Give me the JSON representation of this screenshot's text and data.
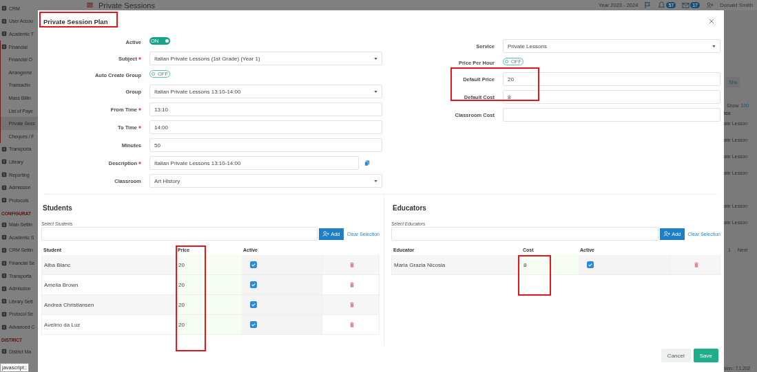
{
  "background": {
    "sidebar": {
      "sections": [
        {
          "items": [
            {
              "label": "CRM",
              "selected": false
            },
            {
              "label": "User Accou",
              "selected": false
            },
            {
              "label": "Academic T",
              "selected": false
            },
            {
              "label": "Financial",
              "selected": false,
              "expanded": true,
              "children": [
                {
                  "label": "Financial O",
                  "selected": false
                },
                {
                  "label": "Arrangeme",
                  "selected": false
                },
                {
                  "label": "Transactio",
                  "selected": false
                },
                {
                  "label": "Mass Billin",
                  "selected": false
                },
                {
                  "label": "List of Paye",
                  "selected": false
                },
                {
                  "label": "Private Sess",
                  "selected": true
                },
                {
                  "label": "Cheques / F",
                  "selected": false
                }
              ]
            },
            {
              "label": "Transporta",
              "selected": false
            },
            {
              "label": "Library",
              "selected": false
            },
            {
              "label": "Reporting",
              "selected": false
            },
            {
              "label": "Admission",
              "selected": false
            },
            {
              "label": "Protocols",
              "selected": false
            }
          ]
        },
        {
          "heading": "CONFIGURAT",
          "items": [
            {
              "label": "Main Settin",
              "selected": false
            },
            {
              "label": "Academic S",
              "selected": false
            },
            {
              "label": "CRM Settin",
              "selected": false
            },
            {
              "label": "Financial Se",
              "selected": false
            },
            {
              "label": "Transporta",
              "selected": false
            },
            {
              "label": "Admission",
              "selected": false
            },
            {
              "label": "Library Sett",
              "selected": false
            },
            {
              "label": "Protocol Se",
              "selected": false
            },
            {
              "label": "Advanced C",
              "selected": false
            }
          ]
        },
        {
          "heading": "DISTRICT",
          "items": [
            {
              "label": "District Ma",
              "selected": false
            }
          ]
        }
      ]
    },
    "header": {
      "title": "Private Sessions",
      "year": "Year 2023 - 2024",
      "badges": [
        "57",
        "17"
      ],
      "user": "Donald Smith"
    },
    "right_strip": {
      "search_button": "Sho",
      "show_label": "Show",
      "page_size": "100",
      "column_header": "ice",
      "row_groups": [
        [
          "ate Lesson",
          "ate Lesson",
          "ate Lesson",
          "ate Lesson"
        ],
        [
          "ate Lesson",
          "ate Lesson"
        ]
      ],
      "pager": [
        "1",
        "Next"
      ],
      "version": "sion : 7.1.202"
    }
  },
  "status_tooltip": "javascript:;",
  "modal": {
    "title": "Private Session Plan",
    "left_fields": [
      {
        "kind": "toggle",
        "label": "Active",
        "required": false,
        "on": true,
        "text": "ON"
      },
      {
        "kind": "select",
        "label": "Subject",
        "required": true,
        "value": "Italian Private Lessons (1st Grade) (Year 1)"
      },
      {
        "kind": "toggle",
        "label": "Auto Create Group",
        "required": false,
        "on": false,
        "text": "OFF"
      },
      {
        "kind": "select",
        "label": "Group",
        "required": false,
        "value": "Italian Private Lessons 13:10-14:00"
      },
      {
        "kind": "input",
        "label": "From Time",
        "required": true,
        "value": "13:10"
      },
      {
        "kind": "input",
        "label": "To Time",
        "required": true,
        "value": "14:00"
      },
      {
        "kind": "input",
        "label": "Minutes",
        "required": false,
        "value": "50"
      },
      {
        "kind": "copy",
        "label": "Description",
        "required": true,
        "value": "Italian Private Lessons  13:10-14:00"
      },
      {
        "kind": "select",
        "label": "Classroom",
        "required": false,
        "value": "Art History"
      }
    ],
    "right_fields": [
      {
        "kind": "select",
        "label": "Service",
        "required": false,
        "value": "Private Lessons"
      },
      {
        "kind": "toggle",
        "label": "Price Per Hour",
        "required": false,
        "on": false,
        "text": "OFF"
      },
      {
        "kind": "input",
        "label": "Default Price",
        "required": false,
        "value": "20"
      },
      {
        "kind": "input",
        "label": "Default Cost",
        "required": false,
        "value": "8"
      },
      {
        "kind": "input",
        "label": "Classroom Cost",
        "required": false
      }
    ],
    "sections": [
      {
        "title": "Students",
        "select_label": "Select Students",
        "add": "Add",
        "clear": "Clear Selection",
        "columns": [
          "Student",
          "Price",
          "Active"
        ],
        "rows": [
          {
            "name": "Alba Blanc",
            "amount": "20",
            "active": true
          },
          {
            "name": "Amelia Brown",
            "amount": "20",
            "active": true
          },
          {
            "name": "Andrea Christiansen",
            "amount": "20",
            "active": true
          },
          {
            "name": "Avelino da Luz",
            "amount": "20",
            "active": true
          }
        ]
      },
      {
        "title": "Educators",
        "select_label": "Select Educators",
        "add": "Add",
        "clear": "Clear Selection",
        "columns": [
          "Educator",
          "Cost",
          "Active"
        ],
        "rows": [
          {
            "name": "Maria Grazia Nicosia",
            "amount": "8",
            "active": true
          }
        ]
      }
    ],
    "buttons": [
      {
        "kind": "cancel",
        "label": "Cancel"
      },
      {
        "kind": "save",
        "label": "Save"
      }
    ],
    "annotation_frames": [
      {
        "kind": "title"
      },
      {
        "kind": "default-price-cost"
      },
      {
        "kind": "price-column"
      },
      {
        "kind": "cost-column"
      }
    ]
  }
}
